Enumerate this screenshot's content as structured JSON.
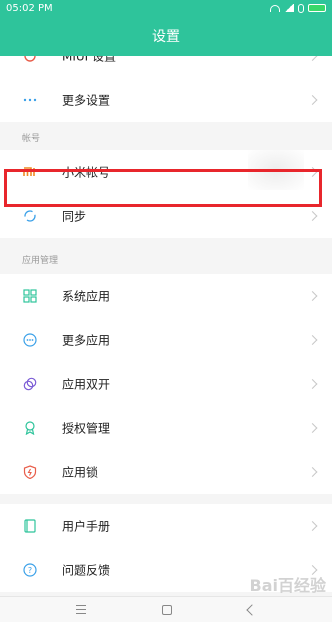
{
  "status": {
    "time": "05:02 PM"
  },
  "title": "设置",
  "rows_top": [
    {
      "label": "MIUI 设置",
      "icon": "gear-icon"
    },
    {
      "label": "更多设置",
      "icon": "more-dots-icon"
    }
  ],
  "section_account": {
    "header": "帐号"
  },
  "account_rows": [
    {
      "label": "小米帐号",
      "icon": "mi-logo-icon"
    },
    {
      "label": "同步",
      "icon": "sync-icon"
    }
  ],
  "section_apps": {
    "header": "应用管理"
  },
  "app_rows": [
    {
      "label": "系统应用",
      "icon": "grid-icon"
    },
    {
      "label": "更多应用",
      "icon": "more-circle-icon"
    },
    {
      "label": "应用双开",
      "icon": "dual-apps-icon"
    },
    {
      "label": "授权管理",
      "icon": "permission-icon"
    },
    {
      "label": "应用锁",
      "icon": "shield-lock-icon"
    }
  ],
  "help_rows": [
    {
      "label": "用户手册",
      "icon": "manual-icon"
    },
    {
      "label": "问题反馈",
      "icon": "help-icon"
    }
  ],
  "watermark": "Bai百经验",
  "colors": {
    "accent": "#2ec49b",
    "highlight": "#e8262c"
  }
}
